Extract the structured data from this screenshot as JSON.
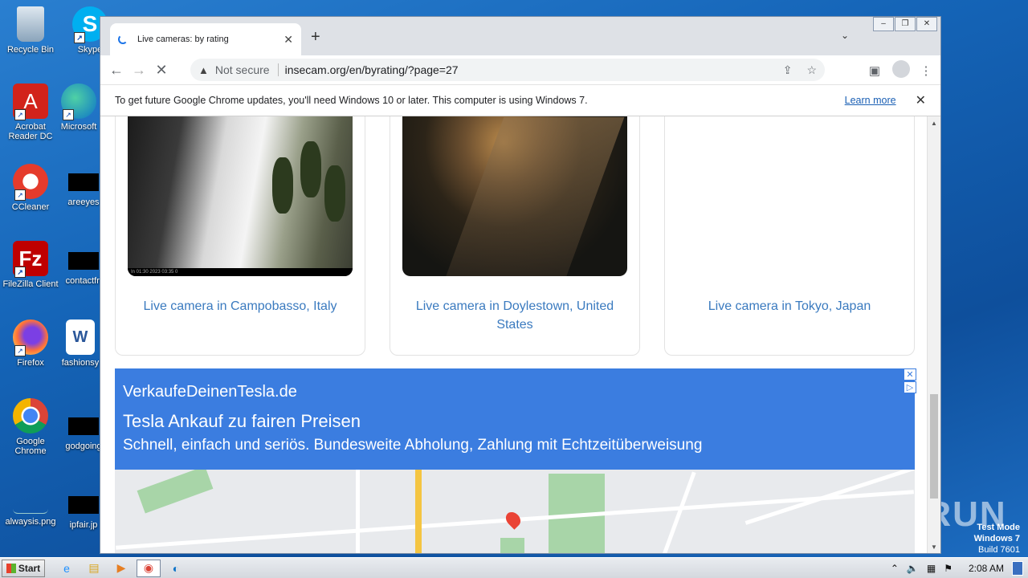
{
  "desktop": {
    "icons": [
      {
        "label": "Recycle Bin",
        "name": "recycle-bin"
      },
      {
        "label": "Skype",
        "name": "skype"
      },
      {
        "label": "Acrobat Reader DC",
        "name": "acrobat"
      },
      {
        "label": "Microsoft",
        "name": "edge"
      },
      {
        "label": "CCleaner",
        "name": "ccleaner"
      },
      {
        "label": "areeyes",
        "name": "areeyes"
      },
      {
        "label": "FileZilla Client",
        "name": "filezilla"
      },
      {
        "label": "contactfri",
        "name": "contactfri"
      },
      {
        "label": "Firefox",
        "name": "firefox"
      },
      {
        "label": "fashionsy",
        "name": "fashionsy"
      },
      {
        "label": "Google Chrome",
        "name": "chrome"
      },
      {
        "label": "godgoing",
        "name": "godgoing"
      },
      {
        "label": "alwaysis.png",
        "name": "alwaysis"
      },
      {
        "label": "ipfair.jp",
        "name": "ipfair"
      }
    ],
    "watermark_line1": "Test Mode",
    "watermark_line2": "Windows 7",
    "watermark_line3": "Build 7601",
    "anyrun": "ANY RUN"
  },
  "browser": {
    "tab_title": "Live cameras: by rating",
    "not_secure": "Not secure",
    "url": "insecam.org/en/byrating/?page=27",
    "infobar_message": "To get future Google Chrome updates, you'll need Windows 10 or later. This computer is using Windows 7.",
    "infobar_link": "Learn more"
  },
  "page": {
    "cards": [
      {
        "caption": "Live camera in Campobasso, Italy",
        "timestamp": "In 01:30 2023 03:35 0"
      },
      {
        "caption": "Live camera in Doylestown, United States"
      },
      {
        "caption": "Live camera in Tokyo, Japan"
      }
    ],
    "ad": {
      "domain": "VerkaufeDeinenTesla.de",
      "headline": "Tesla Ankauf zu fairen Preisen",
      "description": "Schnell, einfach und seriös. Bundesweite Abholung, Zahlung mit Echtzeitüberweisung"
    }
  },
  "taskbar": {
    "start_label": "Start",
    "clock": "2:08 AM"
  },
  "colors": {
    "link": "#3a7abf",
    "ad_bg": "#3b7de0"
  }
}
